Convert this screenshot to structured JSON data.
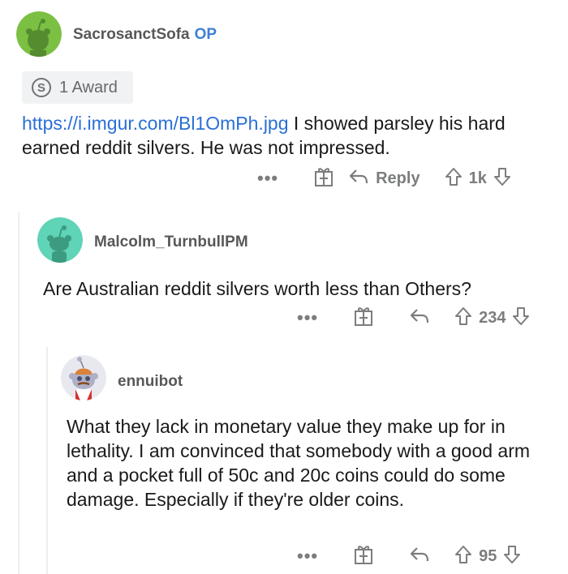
{
  "comments": [
    {
      "username": "SacrosanctSofa",
      "op_tag": "OP",
      "award_count": "1 Award",
      "link": "https://i.imgur.com/Bl1OmPh.jpg",
      "text_after_link": " I showed parsley his hard earned reddit silvers. He was not impressed.",
      "reply_label": "Reply",
      "score": "1k",
      "avatar_color": "#7bc043"
    },
    {
      "username": "Malcolm_TurnbullPM",
      "text": "Are Australian reddit silvers worth less than Others?",
      "score": "234",
      "avatar_color": "#5fd4b6"
    },
    {
      "username": "ennuibot",
      "text": "What they lack in monetary value they make up for in lethality. I am convinced that somebody with a good arm and a pocket full of 50c and 20c coins could do some damage. Especially if they're older coins.",
      "score": "95",
      "avatar_color": "#e8e9ef"
    }
  ],
  "icons": {
    "more": "more-options-icon",
    "gift": "gift-icon",
    "reply": "reply-arrow-icon",
    "upvote": "upvote-arrow-icon",
    "downvote": "downvote-arrow-icon",
    "silver": "silver-award-icon"
  },
  "more_label": "•••",
  "award_coin_glyph": "S"
}
